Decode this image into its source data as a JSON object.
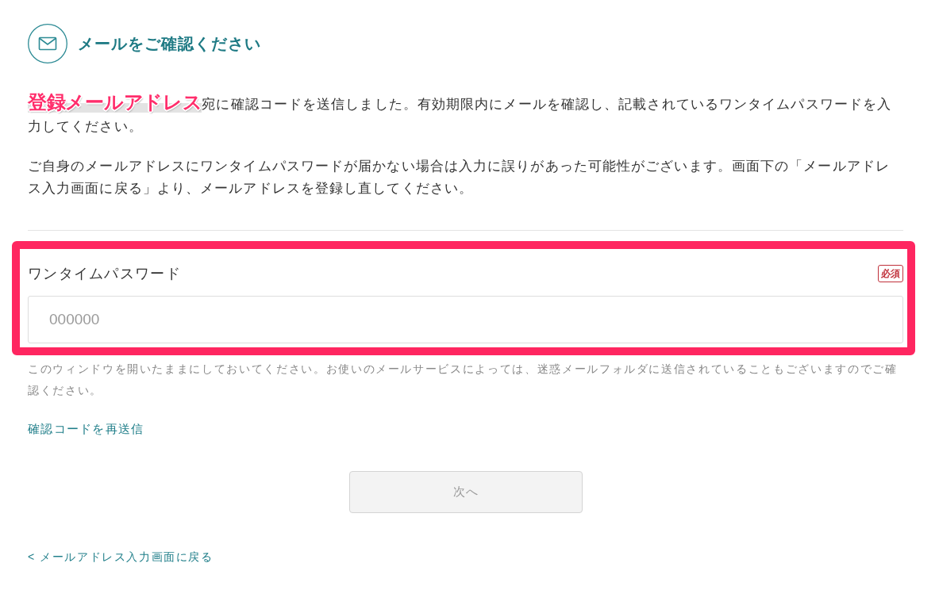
{
  "header": {
    "title": "メールをご確認ください"
  },
  "paragraphs": [
    "**登録メールアドレス**宛に確認コードを送信しました。有効期限内にメールを確認し、記載されているワンタイムパスワードを入力してください。",
    "ご自身のメールアドレスにワンタイムパスワードが届かない場合は入力に誤りがあった可能性がございます。画面下の「メールアドレス入力画面に戻る」より、メールアドレスを登録し直してください。"
  ],
  "otp": {
    "label": "ワンタイムパスワード",
    "badge": "必須",
    "placeholder": "000000",
    "highlighted": true
  },
  "note": "このウィンドウを開いたままにしておいてください。お使いのメールサービスによっては、迷惑メールフォルダに送信されていることもございますのでご確認ください。",
  "resend_link": "確認コードを再送信",
  "next_button": {
    "label": "次へ",
    "disabled": true
  },
  "back_link": "< メールアドレス入力画面に戻る"
}
